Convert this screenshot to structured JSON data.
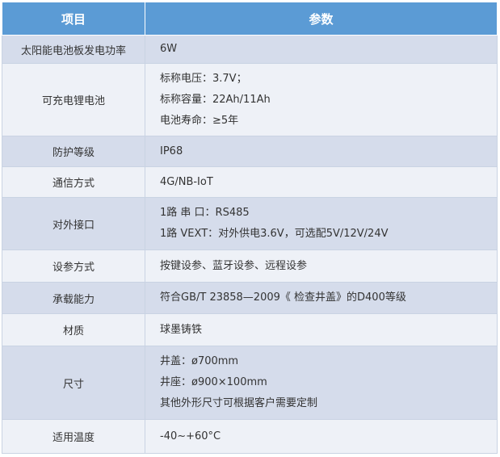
{
  "header": {
    "item": "项目",
    "param": "参数"
  },
  "rows": [
    {
      "item": "太阳能电池板发电功率",
      "values": [
        "6W"
      ]
    },
    {
      "item": "可充电锂电池",
      "values": [
        "标称电压：3.7V；",
        "标称容量：22Ah/11Ah",
        "电池寿命：≥5年"
      ]
    },
    {
      "item": "防护等级",
      "values": [
        "IP68"
      ]
    },
    {
      "item": "通信方式",
      "values": [
        "4G/NB-IoT"
      ]
    },
    {
      "item": "对外接口",
      "values": [
        "1路 串 口：RS485",
        "1路 VEXT：对外供电3.6V，可选配5V/12V/24V"
      ]
    },
    {
      "item": "设参方式",
      "values": [
        "按键设参、蓝牙设参、远程设参"
      ]
    },
    {
      "item": "承载能力",
      "values": [
        " 符合GB/T 23858—2009《 检查井盖》的D400等级"
      ]
    },
    {
      "item": "材质",
      "values": [
        "球墨铸铁"
      ]
    },
    {
      "item": "尺寸",
      "values": [
        "井盖：ø700mm",
        "井座：ø900×100mm",
        "其他外形尺寸可根据客户需要定制"
      ]
    },
    {
      "item": "适用温度",
      "values": [
        "-40~+60°C"
      ]
    }
  ],
  "colors": {
    "header_bg": "#5b9bd5",
    "row_odd": "#d5dceb",
    "row_even": "#eef1f7"
  }
}
